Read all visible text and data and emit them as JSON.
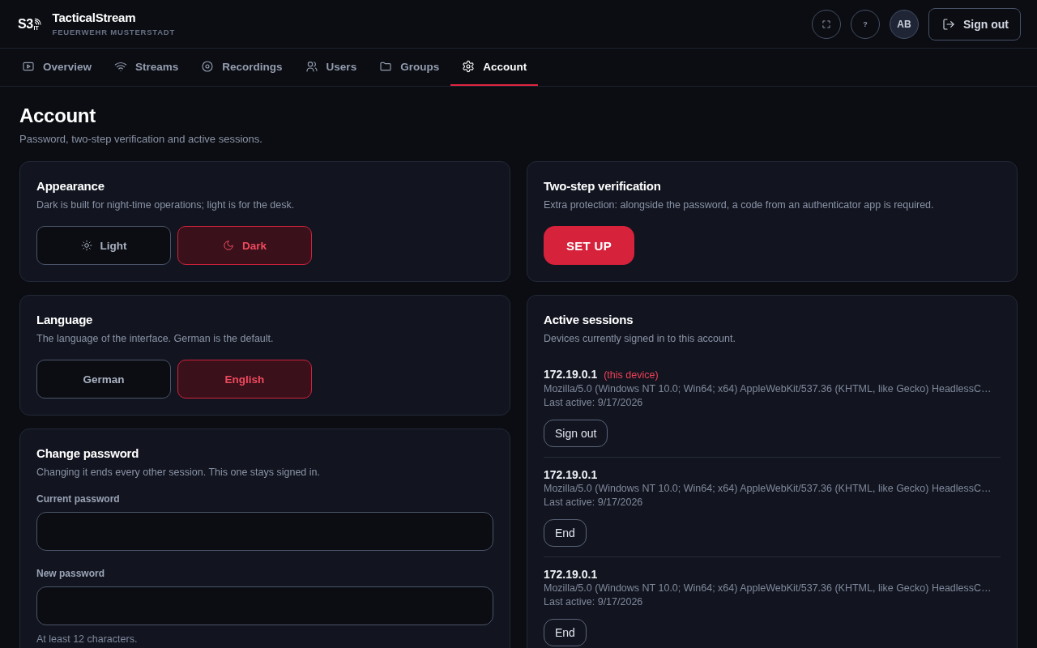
{
  "header": {
    "logo": {
      "mark": "S3",
      "sub": "IT"
    },
    "title": "TacticalStream",
    "subtitle": "FEUERWEHR MUSTERSTADT",
    "actions": [
      {
        "kind": "fullscreen"
      },
      {
        "kind": "help",
        "label": "?"
      },
      {
        "kind": "avatar",
        "label": "AB"
      }
    ],
    "sign_out": "Sign out"
  },
  "tabs": [
    {
      "label": "Overview",
      "selected": false
    },
    {
      "label": "Streams",
      "selected": false
    },
    {
      "label": "Recordings",
      "selected": false
    },
    {
      "label": "Users",
      "selected": false
    },
    {
      "label": "Groups",
      "selected": false
    },
    {
      "label": "Account",
      "selected": true
    }
  ],
  "page": {
    "title": "Account",
    "subtitle": "Password, two-step verification and active sessions."
  },
  "appearance": {
    "title": "Appearance",
    "description": "Dark is built for night-time operations; light is for the desk.",
    "options": [
      {
        "label": "Light",
        "selected": false
      },
      {
        "label": "Dark",
        "selected": true
      }
    ]
  },
  "language": {
    "title": "Language",
    "description": "The language of the interface. German is the default.",
    "options": [
      {
        "label": "German",
        "selected": false
      },
      {
        "label": "English",
        "selected": true
      }
    ]
  },
  "change_password": {
    "title": "Change password",
    "description": "Changing it ends every other session. This one stays signed in.",
    "fields": [
      {
        "label": "Current password"
      },
      {
        "label": "New password",
        "hint": "At least 12 characters."
      }
    ]
  },
  "two_step": {
    "title": "Two-step verification",
    "description": "Extra protection: alongside the password, a code from an authenticator app is required.",
    "button": "SET UP"
  },
  "sessions": {
    "title": "Active sessions",
    "description": "Devices currently signed in to this account.",
    "items": [
      {
        "ip": "172.19.0.1",
        "tag": "(this device)",
        "agent": "Mozilla/5.0 (Windows NT 10.0; Win64; x64) AppleWebKit/537.36 (KHTML, like Gecko) HeadlessC…",
        "last_active": "Last active: 9/17/2026",
        "action": "Sign out"
      },
      {
        "ip": "172.19.0.1",
        "agent": "Mozilla/5.0 (Windows NT 10.0; Win64; x64) AppleWebKit/537.36 (KHTML, like Gecko) HeadlessC…",
        "last_active": "Last active: 9/17/2026",
        "action": "End"
      },
      {
        "ip": "172.19.0.1",
        "agent": "Mozilla/5.0 (Windows NT 10.0; Win64; x64) AppleWebKit/537.36 (KHTML, like Gecko) HeadlessC…",
        "last_active": "Last active: 9/17/2026",
        "action": "End"
      }
    ]
  }
}
